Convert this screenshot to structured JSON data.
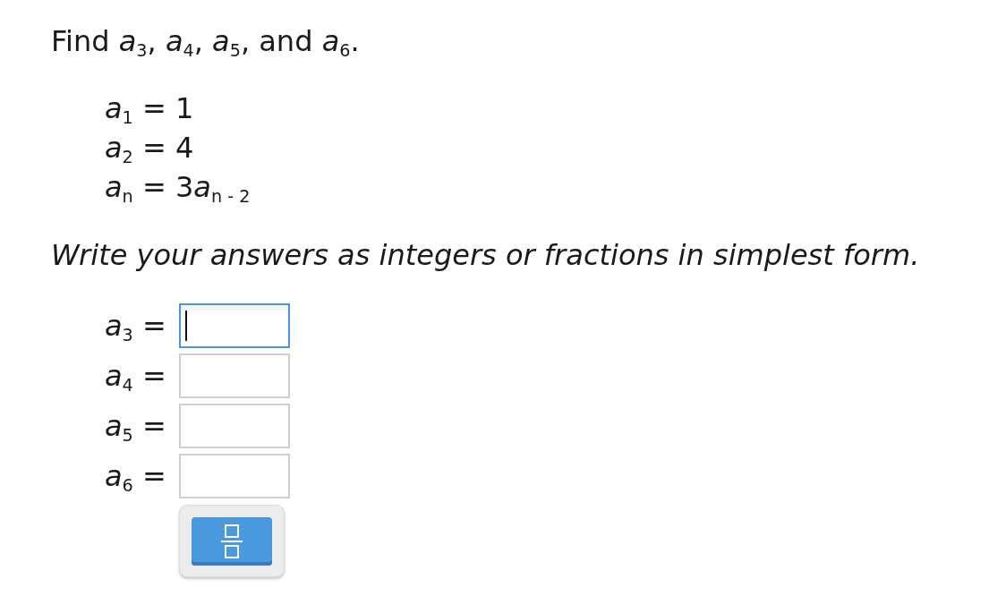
{
  "prompt": "Find *a*$_{3}$, *a*$_{4}$, *a*$_{5}$, and *a*$_{6}$.",
  "givens": [
    [
      "*a*$_{1}$ = 1"
    ],
    [
      "*a*$_{2}$ = 4"
    ],
    [
      "*a*$_{n}$ = 3",
      "*a*$_{n - 2}$"
    ]
  ],
  "instruction": "Write your answers as integers or fractions in simplest form.",
  "answers": [
    {
      "label": "*a*$_{3}$ =",
      "focused": true
    },
    {
      "label": "*a*$_{4}$ =",
      "focused": false
    },
    {
      "label": "*a*$_{5}$ =",
      "focused": false
    },
    {
      "label": "*a*$_{6}$ =",
      "focused": false
    }
  ],
  "palette": {
    "buttons": [
      {
        "kind": "fraction"
      }
    ]
  }
}
